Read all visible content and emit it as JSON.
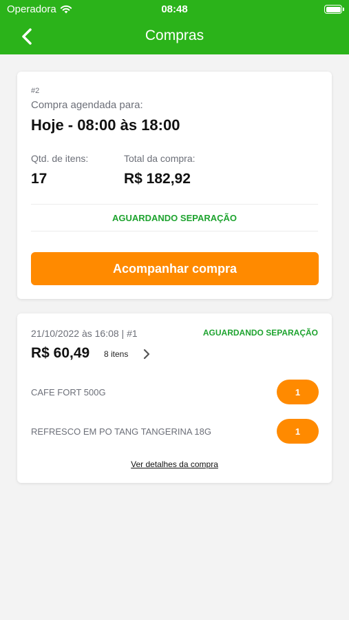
{
  "status_bar": {
    "carrier": "Operadora",
    "time": "08:48"
  },
  "nav": {
    "title": "Compras"
  },
  "current_order": {
    "id": "#2",
    "schedule_label": "Compra agendada para:",
    "schedule_value": "Hoje - 08:00 às 18:00",
    "qty_label": "Qtd. de itens:",
    "qty_value": "17",
    "total_label": "Total da compra:",
    "total_value": "R$ 182,92",
    "status": "AGUARDANDO SEPARAÇÃO",
    "track_button": "Acompanhar compra"
  },
  "past_order": {
    "date_id": "21/10/2022 às 16:08 | #1",
    "status": "AGUARDANDO SEPARAÇÃO",
    "total": "R$ 60,49",
    "item_count": "8 itens",
    "items": [
      {
        "name": "CAFE FORT 500G",
        "qty": "1"
      },
      {
        "name": "REFRESCO EM PO TANG TANGERINA 18G",
        "qty": "1"
      }
    ],
    "details_link": "Ver detalhes da compra"
  },
  "colors": {
    "header_green": "#2bb31a",
    "status_green": "#1ea32f",
    "accent_orange": "#ff8a00",
    "background": "#f3f3f3"
  },
  "icons": {
    "back": "chevron-left-icon",
    "wifi": "wifi-icon",
    "battery": "battery-icon",
    "open_order": "chevron-right-icon"
  }
}
